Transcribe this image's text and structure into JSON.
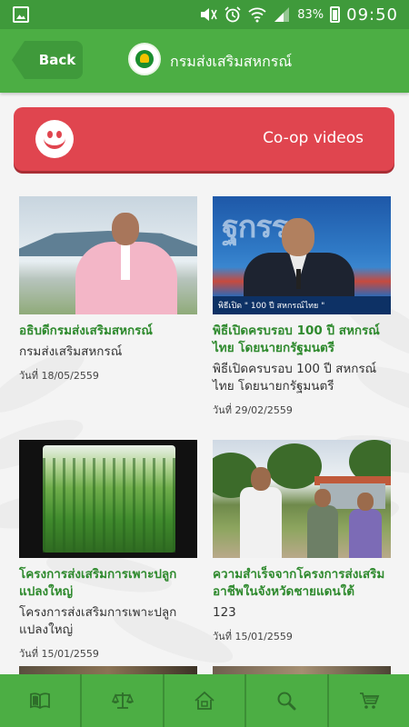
{
  "status_bar": {
    "battery_percent": "83%",
    "time": "09:50"
  },
  "header": {
    "back_label": "Back",
    "title": "กรมส่งเสริมสหกรณ์"
  },
  "banner": {
    "label": "Co-op videos"
  },
  "videos": [
    {
      "title": "อธิบดีกรมส่งเสริมสหกรณ์",
      "description": "กรมส่งเสริมสหกรณ์",
      "date": "วันที่ 18/05/2559"
    },
    {
      "title": "พิธีเปิดครบรอบ 100 ปี สหกรณ์ไทย โดยนายกรัฐมนตรี",
      "description": "พิธีเปิดครบรอบ 100 ปี สหกรณ์ไทย โดยนายกรัฐมนตรี",
      "date": "วันที่ 29/02/2559",
      "thumb_caption": "พิธีเปิด \" 100 ปี สหกรณ์ไทย \""
    },
    {
      "title": "โครงการส่งเสริมการเพาะปลูกแปลงใหญ่",
      "description": "โครงการส่งเสริมการเพาะปลูกแปลงใหญ่",
      "date": "วันที่ 15/01/2559"
    },
    {
      "title": "ความสำเร็จจากโครงการส่งเสริมอาชีพในจังหวัดชายแดนใต้",
      "description": "123",
      "date": "วันที่ 15/01/2559"
    }
  ],
  "bottom_nav": [
    {
      "icon": "book-icon"
    },
    {
      "icon": "scales-icon"
    },
    {
      "icon": "home-icon"
    },
    {
      "icon": "search-icon"
    },
    {
      "icon": "cart-icon"
    }
  ],
  "colors": {
    "header_green": "#4cae44",
    "dark_green": "#3f9a3b",
    "banner_red": "#e0454f",
    "title_green": "#2f8a2e"
  }
}
